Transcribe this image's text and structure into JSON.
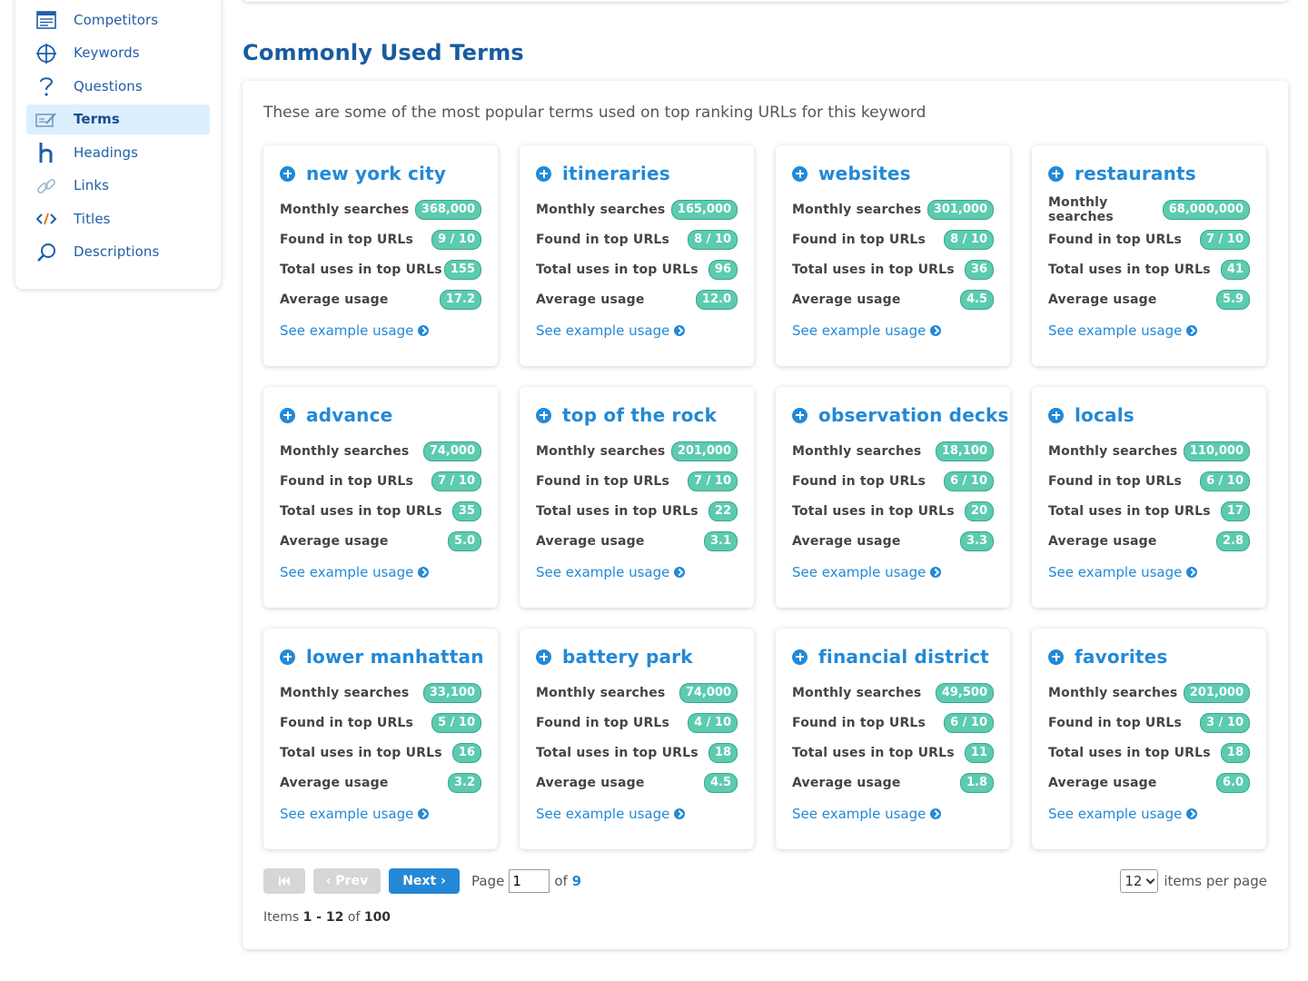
{
  "sidebar": {
    "items": [
      {
        "label": "Competitors",
        "icon": "competitors-icon"
      },
      {
        "label": "Keywords",
        "icon": "keywords-icon"
      },
      {
        "label": "Questions",
        "icon": "questions-icon"
      },
      {
        "label": "Terms",
        "icon": "terms-icon",
        "active": true
      },
      {
        "label": "Headings",
        "icon": "headings-icon"
      },
      {
        "label": "Links",
        "icon": "links-icon"
      },
      {
        "label": "Titles",
        "icon": "titles-icon"
      },
      {
        "label": "Descriptions",
        "icon": "descriptions-icon"
      }
    ]
  },
  "section": {
    "title": "Commonly Used Terms",
    "description": "These are some of the most popular terms used on top ranking URLs for this keyword"
  },
  "labels": {
    "monthly": "Monthly searches",
    "found": "Found in top URLs",
    "total": "Total uses in top URLs",
    "average": "Average usage",
    "see": "See example usage"
  },
  "cards": [
    {
      "term": "new york city",
      "monthly": "368,000",
      "found": "9 / 10",
      "total": "155",
      "average": "17.2"
    },
    {
      "term": "itineraries",
      "monthly": "165,000",
      "found": "8 / 10",
      "total": "96",
      "average": "12.0"
    },
    {
      "term": "websites",
      "monthly": "301,000",
      "found": "8 / 10",
      "total": "36",
      "average": "4.5"
    },
    {
      "term": "restaurants",
      "monthly": "68,000,000",
      "found": "7 / 10",
      "total": "41",
      "average": "5.9"
    },
    {
      "term": "advance",
      "monthly": "74,000",
      "found": "7 / 10",
      "total": "35",
      "average": "5.0"
    },
    {
      "term": "top of the rock",
      "monthly": "201,000",
      "found": "7 / 10",
      "total": "22",
      "average": "3.1"
    },
    {
      "term": "observation decks",
      "monthly": "18,100",
      "found": "6 / 10",
      "total": "20",
      "average": "3.3"
    },
    {
      "term": "locals",
      "monthly": "110,000",
      "found": "6 / 10",
      "total": "17",
      "average": "2.8"
    },
    {
      "term": "lower manhattan",
      "monthly": "33,100",
      "found": "5 / 10",
      "total": "16",
      "average": "3.2"
    },
    {
      "term": "battery park",
      "monthly": "74,000",
      "found": "4 / 10",
      "total": "18",
      "average": "4.5"
    },
    {
      "term": "financial district",
      "monthly": "49,500",
      "found": "6 / 10",
      "total": "11",
      "average": "1.8"
    },
    {
      "term": "favorites",
      "monthly": "201,000",
      "found": "3 / 10",
      "total": "18",
      "average": "6.0"
    }
  ],
  "pagination": {
    "first_label": "⏮",
    "prev_label": "‹ Prev",
    "next_label": "Next ›",
    "page_word": "Page",
    "current_page": "1",
    "of_word": "of",
    "total_pages": "9",
    "per_page_value": "12",
    "per_page_text": "items per page",
    "items_prefix": "Items",
    "items_range": "1 - 12",
    "items_of": "of",
    "items_total": "100"
  },
  "colors": {
    "accent": "#2389d6",
    "badge": "#5ccbb0",
    "title": "#1a5b9e",
    "active_bg": "#dcefff"
  }
}
